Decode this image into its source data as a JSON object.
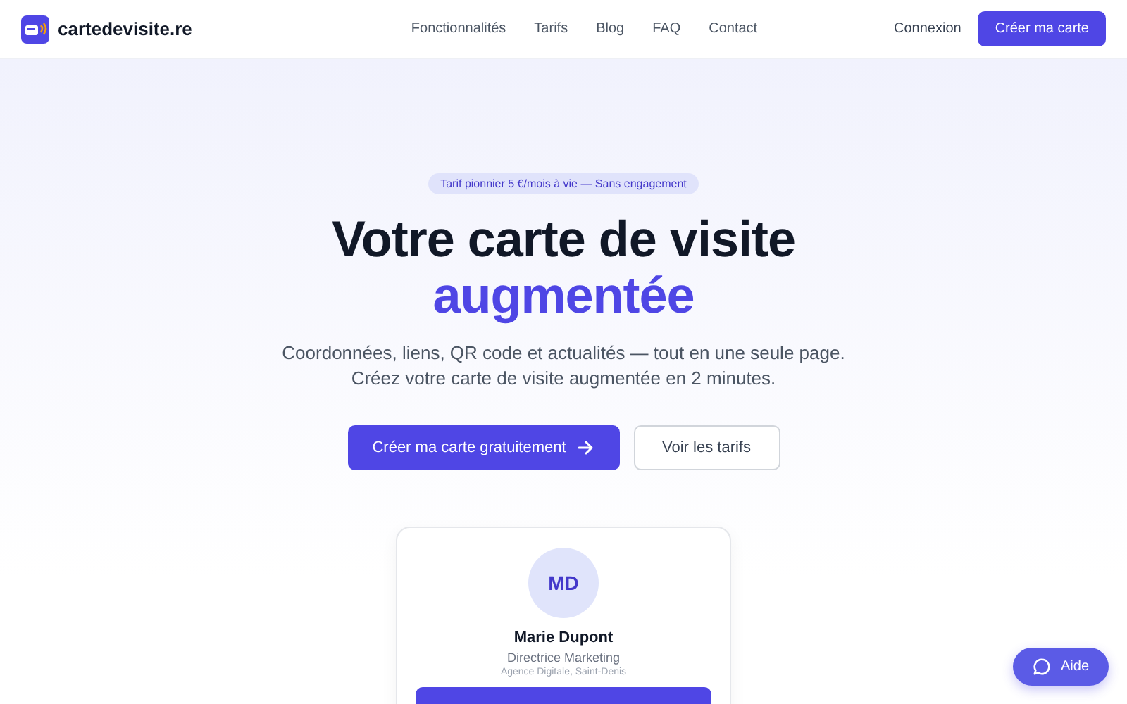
{
  "header": {
    "logo": "cartedevisite.re",
    "nav": [
      "Fonctionnalités",
      "Tarifs",
      "Blog",
      "FAQ",
      "Contact"
    ],
    "login": "Connexion",
    "cta": "Créer ma carte"
  },
  "hero": {
    "badge": "Tarif pionnier 5 €/mois à vie — Sans engagement",
    "title": "Votre carte de visite",
    "title_accent": "augmentée",
    "subtitle": [
      "Coordonnées, liens, QR code et actualités — tout en une seule page.",
      "Créez votre carte de visite augmentée en 2 minutes."
    ],
    "primary_button": "Créer ma carte gratuitement",
    "secondary_button": "Voir les tarifs"
  },
  "card": {
    "initials": "MD",
    "name": "Marie Dupont",
    "role": "Directrice Marketing",
    "company": "Agence Digitale, Saint-Denis"
  },
  "help_button": "Aide"
}
